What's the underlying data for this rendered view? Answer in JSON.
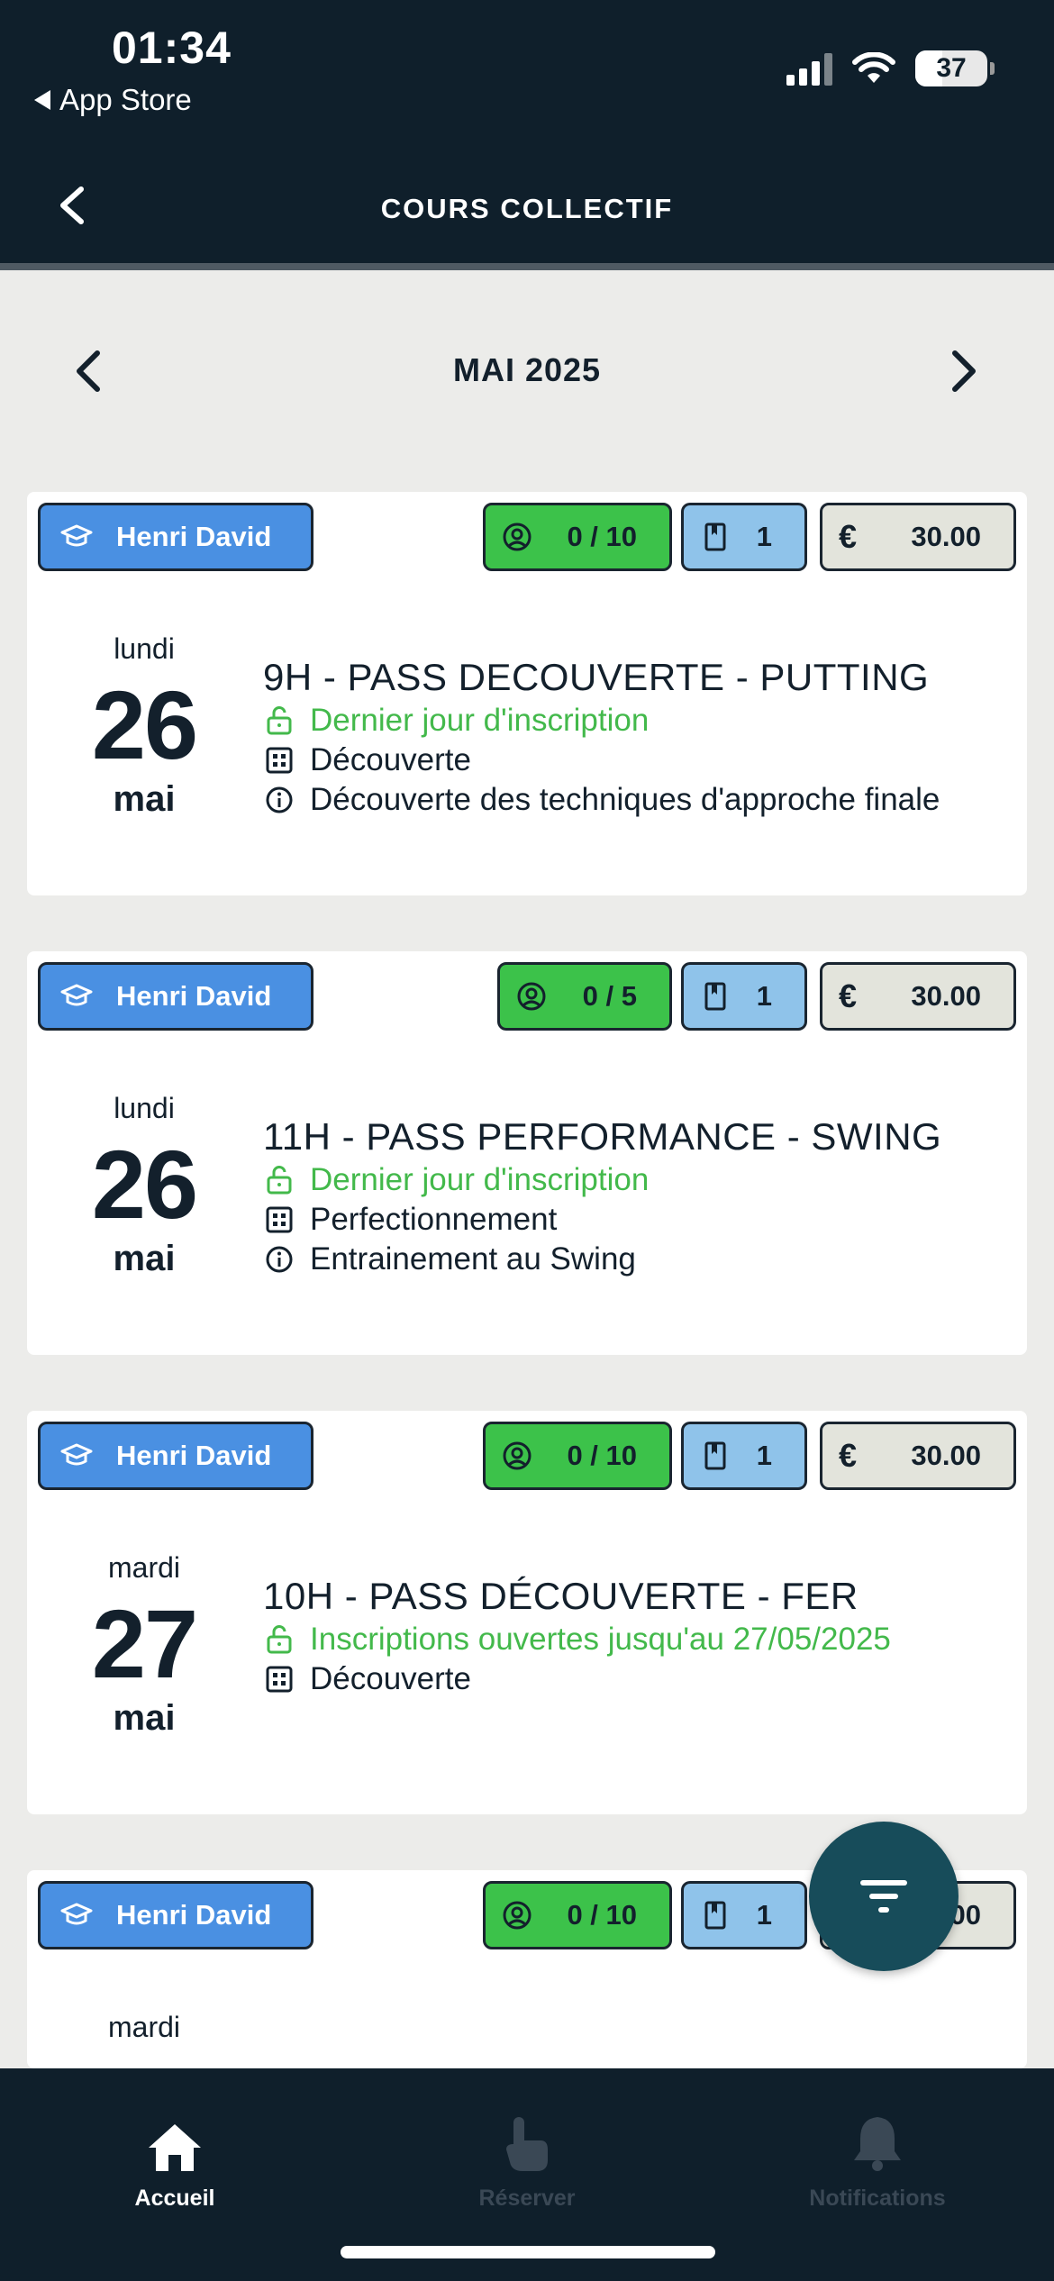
{
  "status_bar": {
    "time": "01:34",
    "back_app": "App Store",
    "battery": "37"
  },
  "header": {
    "title": "COURS COLLECTIF"
  },
  "month_nav": {
    "label": "MAI 2025"
  },
  "courses": [
    {
      "teacher": "Henri David",
      "places": "0 / 10",
      "sessions": "1",
      "price": "30.00",
      "weekday": "lundi",
      "day": "26",
      "month": "mai",
      "title": "9H - PASS DECOUVERTE - PUTTING",
      "registration": "Dernier jour d'inscription",
      "level": "Découverte",
      "description": "Découverte des techniques d'approche finale"
    },
    {
      "teacher": "Henri David",
      "places": "0 / 5",
      "sessions": "1",
      "price": "30.00",
      "weekday": "lundi",
      "day": "26",
      "month": "mai",
      "title": "11H - PASS PERFORMANCE - SWING",
      "registration": "Dernier jour d'inscription",
      "level": "Perfectionnement",
      "description": "Entrainement au Swing"
    },
    {
      "teacher": "Henri David",
      "places": "0 / 10",
      "sessions": "1",
      "price": "30.00",
      "weekday": "mardi",
      "day": "27",
      "month": "mai",
      "title": "10H - PASS DÉCOUVERTE - FER",
      "registration": "Inscriptions ouvertes jusqu'au 27/05/2025",
      "level": "Découverte",
      "description": ""
    },
    {
      "teacher": "Henri David",
      "places": "0 / 10",
      "sessions": "1",
      "price": "30.00",
      "weekday": "mardi"
    }
  ],
  "tabs": [
    {
      "label": "Accueil",
      "icon": "home-icon",
      "active": true
    },
    {
      "label": "Réserver",
      "icon": "tap-hand-icon",
      "active": false
    },
    {
      "label": "Notifications",
      "icon": "bell-icon",
      "active": false
    }
  ],
  "colors": {
    "header_bg": "#0f1f2b",
    "teacher_pill": "#4a90e2",
    "places_pill": "#3cc24a",
    "sessions_pill": "#8fc3ea",
    "price_pill": "#e3e4dc",
    "registration_text": "#43b94b",
    "fab": "#174c5a"
  }
}
